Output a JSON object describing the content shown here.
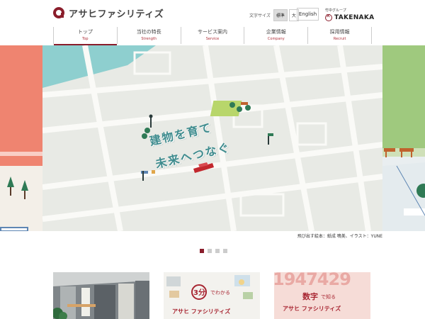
{
  "header": {
    "logo_text": "アサヒファシリティズ",
    "font_size_label": "文字サイズ",
    "font_size_options": [
      "標準",
      "大"
    ],
    "english_label": "English",
    "group_label": "竹中グループ",
    "group_brand": "TAKENAKA"
  },
  "nav": {
    "items": [
      {
        "jp": "トップ",
        "en": "Top"
      },
      {
        "jp": "当社の特長",
        "en": "Strength"
      },
      {
        "jp": "サービス案内",
        "en": "Service"
      },
      {
        "jp": "企業情報",
        "en": "Company"
      },
      {
        "jp": "採用情報",
        "en": "Recruit"
      }
    ]
  },
  "hero": {
    "headline_1": "建物を育て",
    "headline_2": "未来へつなぐ",
    "caption": "飛び出す絵本：紙成 鳴美、イラスト：YUNE"
  },
  "cards": {
    "card2_text_1": "3分",
    "card2_text_2": "でわかる",
    "card2_text_3": "アサヒ ファシリティズ",
    "card3_text_1": "数字",
    "card3_text_2": "で知る",
    "card3_text_3": "アサヒ ファシリティズ",
    "card3_bg_digits": "1947429"
  },
  "colors": {
    "brand": "#8a1d2b",
    "nav_en": "#b0303a"
  }
}
